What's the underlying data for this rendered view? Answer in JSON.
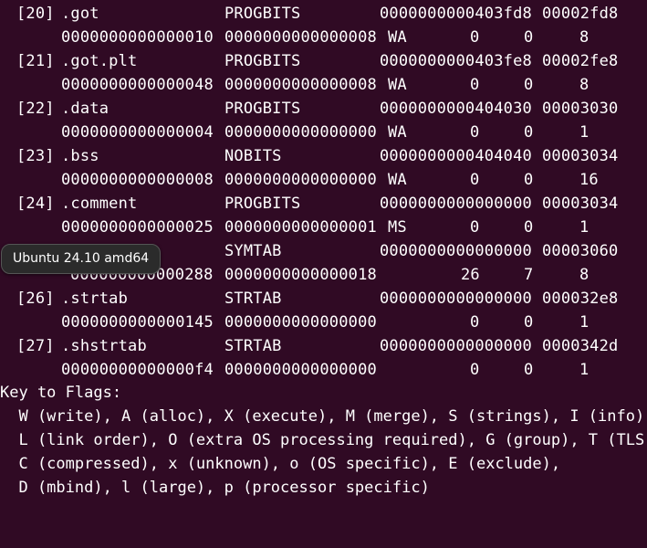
{
  "terminal": {
    "rows": [
      {
        "idx": "[20]",
        "name": ".got",
        "type": "PROGBITS",
        "address": "0000000000403fd8",
        "offset": "00002fd8",
        "size": "0000000000000010",
        "entsize": "0000000000000008",
        "flags": "WA",
        "link": "0",
        "info": "0",
        "align": "8"
      },
      {
        "idx": "[21]",
        "name": ".got.plt",
        "type": "PROGBITS",
        "address": "0000000000403fe8",
        "offset": "00002fe8",
        "size": "0000000000000048",
        "entsize": "0000000000000008",
        "flags": "WA",
        "link": "0",
        "info": "0",
        "align": "8"
      },
      {
        "idx": "[22]",
        "name": ".data",
        "type": "PROGBITS",
        "address": "0000000000404030",
        "offset": "00003030",
        "size": "0000000000000004",
        "entsize": "0000000000000000",
        "flags": "WA",
        "link": "0",
        "info": "0",
        "align": "1"
      },
      {
        "idx": "[23]",
        "name": ".bss",
        "type": "NOBITS",
        "address": "0000000000404040",
        "offset": "00003034",
        "size": "0000000000000008",
        "entsize": "0000000000000000",
        "flags": "WA",
        "link": "0",
        "info": "0",
        "align": "16"
      },
      {
        "idx": "[24]",
        "name": ".comment",
        "type": "PROGBITS",
        "address": "0000000000000000",
        "offset": "00003034",
        "size": "0000000000000025",
        "entsize": "0000000000000001",
        "flags": "MS",
        "link": "0",
        "info": "0",
        "align": "1"
      },
      {
        "idx": "",
        "name": "",
        "type": "SYMTAB",
        "address": "0000000000000000",
        "offset": "00003060",
        "size": "000000000000288",
        "entsize": "0000000000000018",
        "flags": "",
        "link": "26",
        "info": "7",
        "align": "8"
      },
      {
        "idx": "[26]",
        "name": ".strtab",
        "type": "STRTAB",
        "address": "0000000000000000",
        "offset": "000032e8",
        "size": "0000000000000145",
        "entsize": "0000000000000000",
        "flags": "",
        "link": "0",
        "info": "0",
        "align": "1"
      },
      {
        "idx": "[27]",
        "name": ".shstrtab",
        "type": "STRTAB",
        "address": "0000000000000000",
        "offset": "0000342d",
        "size": "00000000000000f4",
        "entsize": "0000000000000000",
        "flags": "",
        "link": "0",
        "info": "0",
        "align": "1"
      }
    ],
    "key_title": "Key to Flags:",
    "key_lines": [
      "  W (write), A (alloc), X (execute), M (merge), S (strings), I (info),",
      "  L (link order), O (extra OS processing required), G (group), T (TLS),",
      "  C (compressed), x (unknown), o (OS specific), E (exclude),",
      "  D (mbind), l (large), p (processor specific)"
    ]
  },
  "tooltip": {
    "text": "Ubuntu 24.10 amd64"
  },
  "colors": {
    "background": "#300a24",
    "foreground": "#ffffff",
    "tooltip_bg": "#2b2b2b"
  }
}
